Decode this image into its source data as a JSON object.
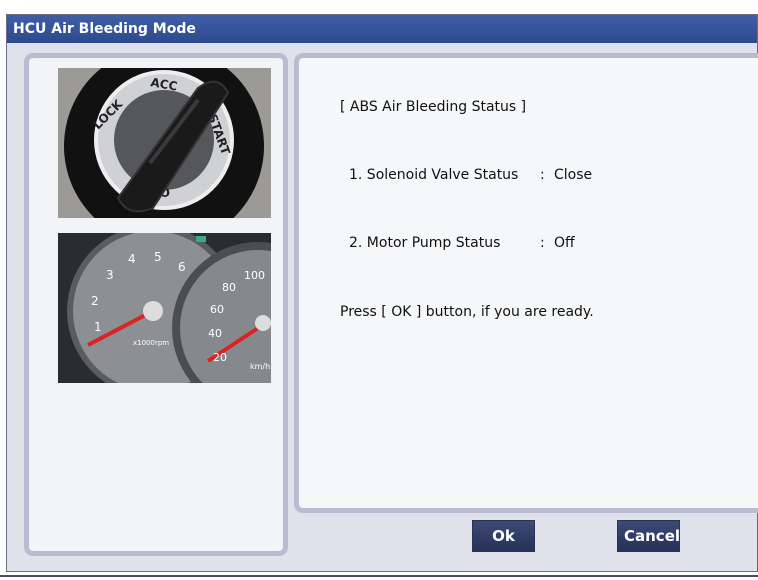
{
  "window": {
    "title": "HCU Air Bleeding Mode"
  },
  "images": {
    "ignition": {
      "icon": "ignition-switch-photo",
      "text": [
        "LOCK",
        "ACC",
        "START",
        "ON"
      ]
    },
    "gauge": {
      "icon": "instrument-cluster-photo",
      "tach_ticks": [
        "1",
        "2",
        "3",
        "4",
        "5",
        "6",
        "x1000rpm"
      ],
      "speed_ticks": [
        "20",
        "40",
        "60",
        "80",
        "100",
        "km/h"
      ]
    }
  },
  "status": {
    "heading": "[ ABS Air Bleeding Status ]",
    "solenoid": {
      "label": "1. Solenoid Valve Status",
      "separator": ":",
      "value": "Close"
    },
    "motor": {
      "label": "2. Motor Pump Status",
      "separator": ":",
      "value": "Off"
    },
    "instruction": "Press [ OK ] button, if you are ready."
  },
  "buttons": {
    "ok": "Ok",
    "cancel": "Cancel"
  }
}
